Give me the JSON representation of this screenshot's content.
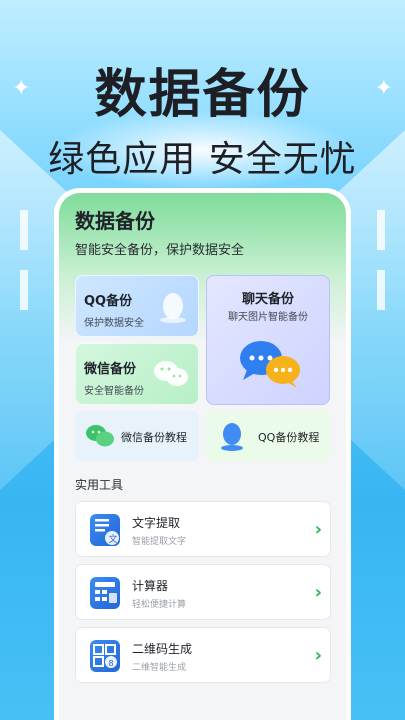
{
  "promo": {
    "headline": "数据备份",
    "subheadline": "绿色应用 安全无忧"
  },
  "app": {
    "title": "数据备份",
    "subtitle": "智能安全备份，保护数据安全"
  },
  "cards": {
    "qq": {
      "title": "QQ备份",
      "desc": "保护数据安全"
    },
    "wechat": {
      "title": "微信备份",
      "desc": "安全智能备份"
    },
    "chat": {
      "title": "聊天备份",
      "desc": "聊天图片智能备份"
    }
  },
  "tutorials": {
    "wechat": "微信备份教程",
    "qq": "QQ备份教程"
  },
  "tools_section": "实用工具",
  "tools": [
    {
      "title": "文字提取",
      "desc": "智能提取文字",
      "icon": "text-extract-icon"
    },
    {
      "title": "计算器",
      "desc": "轻松便捷计算",
      "icon": "calculator-icon"
    },
    {
      "title": "二维码生成",
      "desc": "二维智能生成",
      "icon": "qrcode-icon"
    }
  ],
  "colors": {
    "accent_green": "#27b45a",
    "background_blue": "#38b6f2",
    "tool_icon_blue": "#2466d6"
  }
}
